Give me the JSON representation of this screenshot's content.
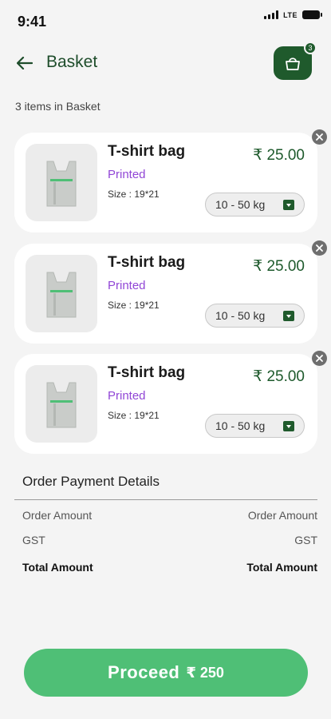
{
  "status_bar": {
    "time": "9:41",
    "network": "LTE"
  },
  "header": {
    "title": "Basket",
    "basket_count": "3"
  },
  "items_count_label": "3 items in Basket",
  "items": [
    {
      "name": "T-shirt bag",
      "type": "Printed",
      "size": "Size : 19*21",
      "price": "₹ 25.00",
      "weight": "10 - 50 kg"
    },
    {
      "name": "T-shirt bag",
      "type": "Printed",
      "size": "Size : 19*21",
      "price": "₹ 25.00",
      "weight": "10 - 50 kg"
    },
    {
      "name": "T-shirt bag",
      "type": "Printed",
      "size": "Size : 19*21",
      "price": "₹ 25.00",
      "weight": "10 - 50 kg"
    }
  ],
  "payment": {
    "title": "Order Payment Details",
    "rows": [
      {
        "label": "Order Amount",
        "value": "Order Amount"
      },
      {
        "label": "GST",
        "value": "GST"
      },
      {
        "label": "Total Amount",
        "value": "Total Amount"
      }
    ]
  },
  "proceed": {
    "label": "Proceed",
    "amount": "₹ 250"
  },
  "colors": {
    "brand_dark": "#1f5a2c",
    "brand_light": "#4fbf76",
    "accent_purple": "#9146d6"
  }
}
